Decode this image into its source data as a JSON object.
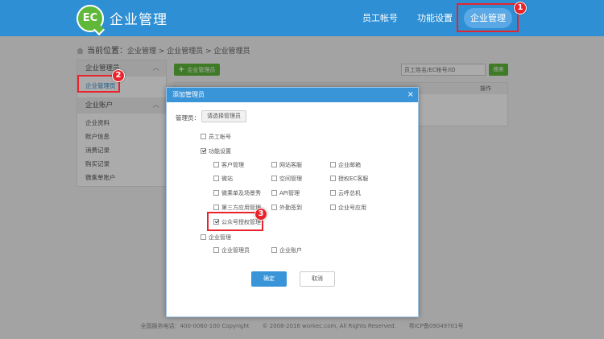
{
  "header": {
    "logo_text": "EC",
    "brand": "企业管理",
    "nav": {
      "staff": "员工帐号",
      "func": "功能设置",
      "enterprise": "企业管理"
    }
  },
  "breadcrumb": {
    "label": "当前位置：",
    "path": "企业管理 > 企业管理员 > 企业管理员"
  },
  "sidebar": {
    "group1": "企业管理员",
    "item_admin": "企业管理员",
    "group2": "企业账户",
    "items": [
      "企业资料",
      "账户信息",
      "消费记录",
      "购买记录",
      "微乘单账户"
    ]
  },
  "main": {
    "add_button": "企业管理员",
    "search_placeholder": "员工姓名/EC帐号/ID",
    "search_button": "搜索",
    "table_op": "操作"
  },
  "modal": {
    "title": "添加管理员",
    "close": "×",
    "admin_label": "管理员：",
    "choose_button": "请选择管理员",
    "staff_account": "员工帐号",
    "func_settings": "功能设置",
    "func_items": [
      "客户管理",
      "网站客服",
      "企业邮箱",
      "微站",
      "空间管理",
      "授权EC客服",
      "微乘单及场景秀",
      "API管理",
      "云呼总机",
      "第三方应用管理",
      "外勤签到",
      "企业号应用",
      "公众号授权管理"
    ],
    "enterprise_mgmt": "企业管理",
    "ent_items": [
      "企业管理员",
      "企业账户"
    ],
    "ok": "确定",
    "cancel": "取消"
  },
  "markers": [
    "1",
    "2",
    "3"
  ],
  "footer": {
    "hotline": "全国服务电话：400-0060-100 Copyright",
    "copyright": "© 2008-2016 workec.com, All Rights Reserved.",
    "icp": "粤ICP备09049701号"
  },
  "colors": {
    "header": "#2e8fd4",
    "accent_green": "#5fb83a",
    "highlight": "#e8232b"
  }
}
